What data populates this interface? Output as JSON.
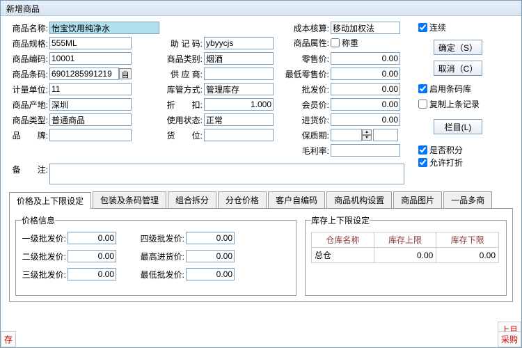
{
  "title": "新增商品",
  "labels": {
    "name": "商品名称:",
    "spec": "商品规格:",
    "code": "商品编码:",
    "barcode": "商品条码:",
    "unit": "计量单位:",
    "origin": "商品产地:",
    "type": "商品类型:",
    "brand": "品　　牌:",
    "mnemonic": "助 记 码:",
    "category": "商品类别:",
    "supplier": "供 应 商:",
    "stockMode": "库管方式:",
    "discount": "折　　扣:",
    "status": "使用状态:",
    "pos": "货　　位:",
    "cost": "成本核算:",
    "attr": "商品属性:",
    "retail": "零售价:",
    "minRetail": "最低零售价:",
    "wholesale": "批发价:",
    "member": "会员价:",
    "purchase": "进货价:",
    "shelf": "保质期:",
    "margin": "毛利率:",
    "remark": "备　　注:",
    "auto": "自"
  },
  "values": {
    "name": "怡宝饮用纯净水",
    "spec": "555ML",
    "code": "10001",
    "barcode": "6901285991219",
    "unit": "11",
    "origin": "深圳",
    "type": "普通商品",
    "brand": "",
    "mnemonic": "ybyycjs",
    "category": "烟酒",
    "supplier": "",
    "stockMode": "管理库存",
    "discount": "1.000",
    "status": "正常",
    "pos": "",
    "cost": "移动加权法",
    "attr": "",
    "retail": "0.00",
    "minRetail": "0.00",
    "wholesale": "0.00",
    "member": "0.00",
    "purchase": "0.00",
    "shelf": "",
    "shelfUnit": "",
    "margin": "",
    "remark": ""
  },
  "checkboxes": {
    "continuous": "连续",
    "weigh": "称重",
    "enableBarcode": "启用条码库",
    "copyPrev": "复制上条记录",
    "points": "是否积分",
    "allowDiscount": "允许打折"
  },
  "checked": {
    "continuous": true,
    "weigh": false,
    "enableBarcode": true,
    "copyPrev": false,
    "points": true,
    "allowDiscount": true
  },
  "buttons": {
    "ok": "确定（S）",
    "cancel": "取消（C）",
    "column": "栏目(L)"
  },
  "tabs": [
    "价格及上下限设定",
    "包装及条码管理",
    "组合拆分",
    "分仓价格",
    "客户自编码",
    "商品机构设置",
    "商品图片",
    "一品多商"
  ],
  "priceInfo": {
    "legend": "价格信息",
    "lv1": "一级批发价:",
    "lv2": "二级批发价:",
    "lv3": "三级批发价:",
    "lv4": "四级批发价:",
    "maxIn": "最高进货价:",
    "minOut": "最低批发价:",
    "v1": "0.00",
    "v2": "0.00",
    "v3": "0.00",
    "v4": "0.00",
    "vMaxIn": "0.00",
    "vMinOut": "0.00"
  },
  "stockLimit": {
    "legend": "库存上下限设定",
    "cols": [
      "仓库名称",
      "库存上限",
      "库存下限"
    ],
    "row": {
      "name": "总仓",
      "upper": "0.00",
      "lower": "0.00"
    }
  },
  "footer": {
    "left": "存",
    "right1": "上月",
    "right2": "采购"
  }
}
